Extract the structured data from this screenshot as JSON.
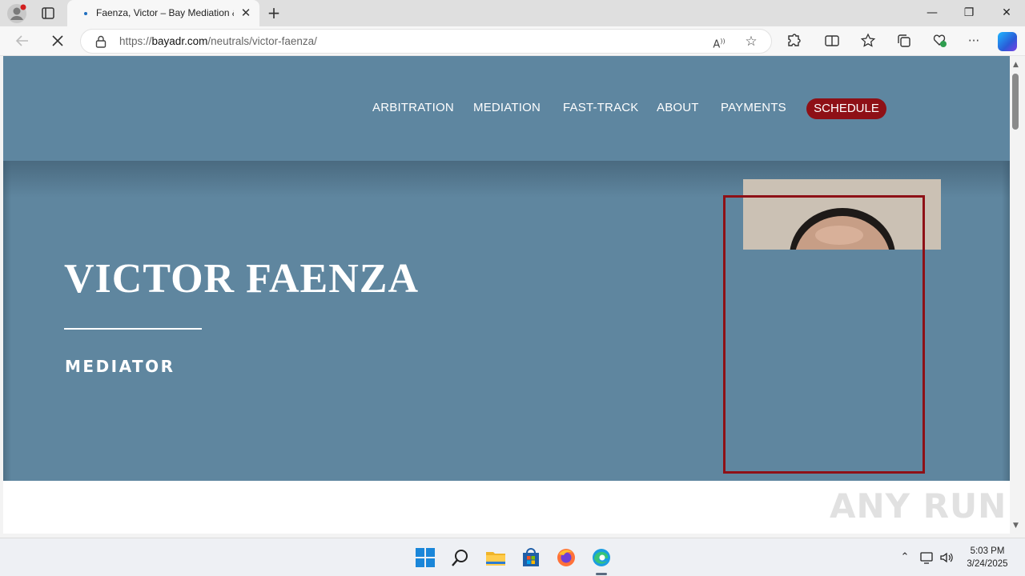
{
  "browser": {
    "tab": {
      "title": "Faenza, Victor – Bay Mediation &"
    },
    "address": {
      "scheme_prefix": "https://",
      "host": "bayadr.com",
      "path": "/neutrals/victor-faenza/"
    },
    "icons": {
      "profile": "profile-icon",
      "tab_actions": "tab-actions-icon",
      "close_tab": "close-icon",
      "new_tab": "plus-icon",
      "back": "back-arrow-icon",
      "stop": "stop-loading-icon",
      "lock": "lock-icon",
      "read_aloud": "read-aloud-icon",
      "favorite": "star-icon",
      "extensions": "extensions-icon",
      "split_screen": "split-screen-icon",
      "favorites": "favorites-icon",
      "collections": "collections-icon",
      "browser_essentials": "browser-essentials-icon",
      "more": "more-icon",
      "copilot": "copilot-icon"
    },
    "window_controls": {
      "minimize": "—",
      "restore": "❐",
      "close": "✕"
    },
    "tab_close_glyph": "✕",
    "new_tab_glyph": "+"
  },
  "page": {
    "nav": [
      "ARBITRATION",
      "MEDIATION",
      "FAST-TRACK",
      "ABOUT",
      "PAYMENTS"
    ],
    "nav_cta": "SCHEDULE",
    "hero": {
      "name": "VICTOR FAENZA",
      "role": "MEDIATOR"
    },
    "colors": {
      "header_bg": "#5e86a0",
      "accent": "#8e1016"
    }
  },
  "watermark": "ANY RUN",
  "taskbar": {
    "icons": [
      "windows-start-icon",
      "search-icon",
      "file-explorer-icon",
      "microsoft-store-icon",
      "firefox-icon",
      "edge-icon"
    ],
    "tray": [
      "chevron-up-icon",
      "network-icon",
      "volume-icon"
    ],
    "time": "5:03 PM",
    "date": "3/24/2025"
  }
}
